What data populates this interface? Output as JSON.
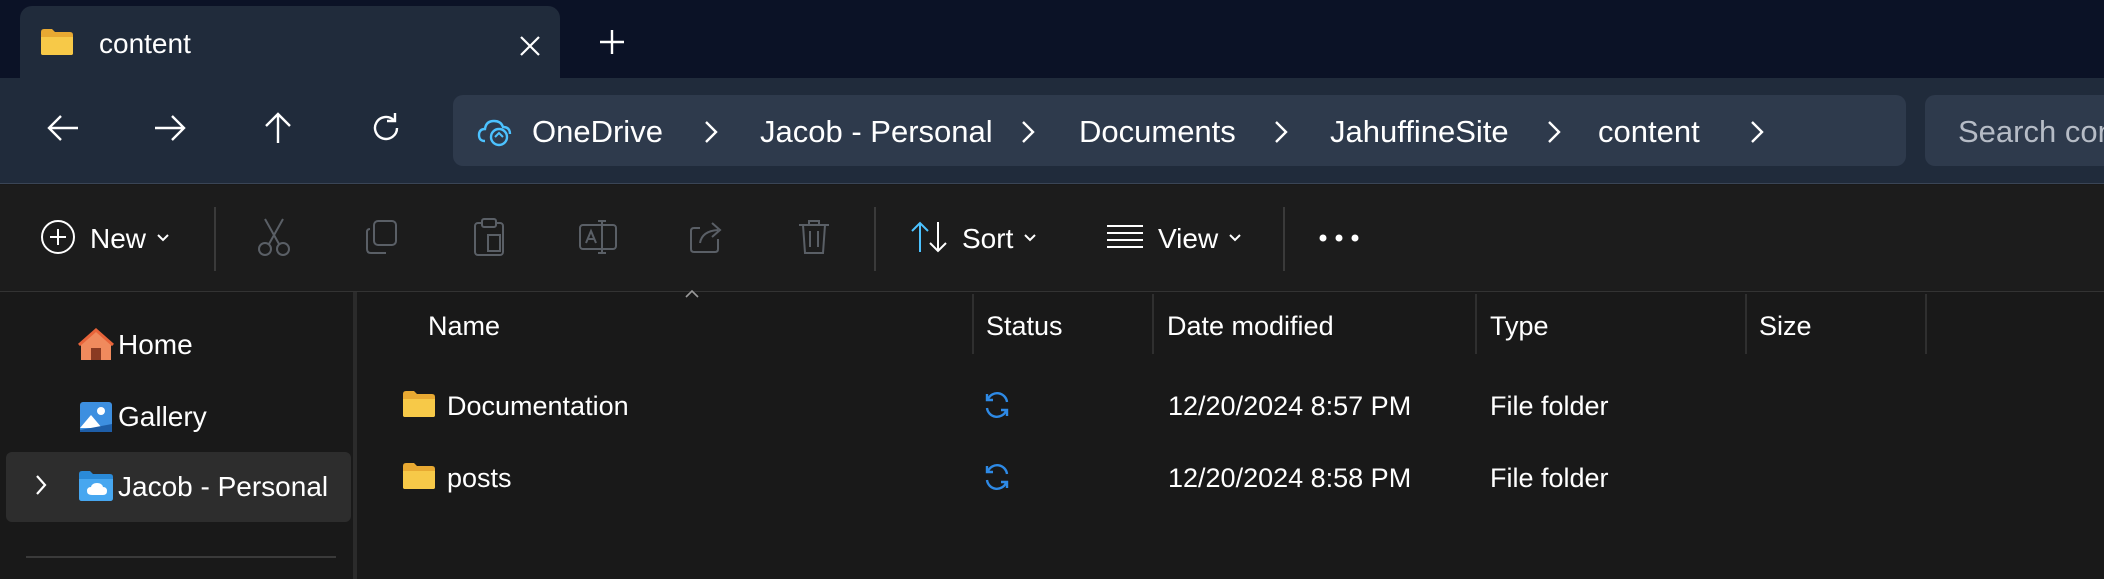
{
  "window": {
    "tab_title": "content",
    "tab_icon": "folder-icon"
  },
  "navigation": {
    "back_icon": "arrow-left-icon",
    "forward_icon": "arrow-right-icon",
    "up_icon": "arrow-up-icon",
    "refresh_icon": "refresh-icon"
  },
  "address_bar": {
    "crumbs": [
      "OneDrive",
      "Jacob - Personal",
      "Documents",
      "JahuffineSite",
      "content"
    ]
  },
  "search": {
    "placeholder": "Search content"
  },
  "command_bar": {
    "new_label": "New",
    "sort_label": "Sort",
    "view_label": "View"
  },
  "nav_pane": {
    "items": [
      {
        "label": "Home"
      },
      {
        "label": "Gallery"
      },
      {
        "label": "Jacob - Personal"
      }
    ]
  },
  "file_list": {
    "columns": [
      "Name",
      "Status",
      "Date modified",
      "Type",
      "Size"
    ],
    "rows": [
      {
        "name": "Documentation",
        "date_modified": "12/20/2024 8:57 PM",
        "type": "File folder",
        "size": ""
      },
      {
        "name": "posts",
        "date_modified": "12/20/2024 8:58 PM",
        "type": "File folder",
        "size": ""
      }
    ]
  },
  "colors": {
    "title_bar": "#0b1226",
    "nav_bar": "#202b3b",
    "address_bg": "#2e3a4c",
    "content_bg": "#191919",
    "accent_blue": "#4cc2ff",
    "folder_yellow": "#f7c948"
  }
}
